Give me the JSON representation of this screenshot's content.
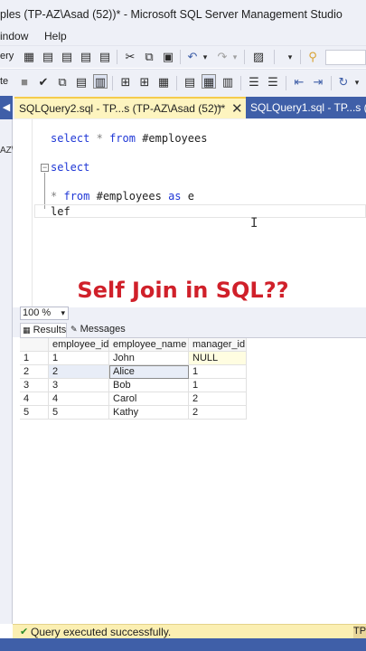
{
  "window": {
    "title": "ples (TP-AZ\\Asad (52))* - Microsoft SQL Server Management Studio"
  },
  "menu": {
    "items": [
      "indow",
      "Help"
    ]
  },
  "toolbar1": {
    "left_text": "ery",
    "dropdown_placeholder": ""
  },
  "toolbar2": {
    "left_text": "te"
  },
  "tabs": [
    {
      "label": "SQLQuery2.sql - TP...s (TP-AZ\\Asad (52))*",
      "active": true
    },
    {
      "label": "SQLQuery1.sql - TP...s (",
      "active": false
    }
  ],
  "left_panel": {
    "label": "AZ\\"
  },
  "editor": {
    "lines": [
      {
        "kw": "select",
        "op": "*",
        "kw2": "from",
        "rest": " #employees"
      },
      {
        "kw": "select"
      },
      {
        "op": "*",
        "kw": "from",
        "mid": " #employees ",
        "kw2": "as",
        "rest": " e"
      },
      {
        "text": "lef"
      }
    ]
  },
  "caption": "Self Join in SQL??",
  "zoom": {
    "value": "100 %"
  },
  "results_tabs": {
    "results": "Results",
    "messages": "Messages"
  },
  "grid": {
    "columns": [
      "employee_id",
      "employee_name",
      "manager_id"
    ],
    "rows": [
      {
        "num": "1",
        "cells": [
          "1",
          "John",
          "NULL"
        ]
      },
      {
        "num": "2",
        "cells": [
          "2",
          "Alice",
          "1"
        ]
      },
      {
        "num": "3",
        "cells": [
          "3",
          "Bob",
          "1"
        ]
      },
      {
        "num": "4",
        "cells": [
          "4",
          "Carol",
          "2"
        ]
      },
      {
        "num": "5",
        "cells": [
          "5",
          "Kathy",
          "2"
        ]
      }
    ]
  },
  "status": {
    "message": "Query executed successfully.",
    "right": "TP"
  },
  "colors": {
    "accent": "#3f5fa8",
    "active_tab": "#fdf4bf",
    "caption": "#d0202a",
    "keyword": "#1f37d6",
    "status_bar": "#fbefb2"
  }
}
